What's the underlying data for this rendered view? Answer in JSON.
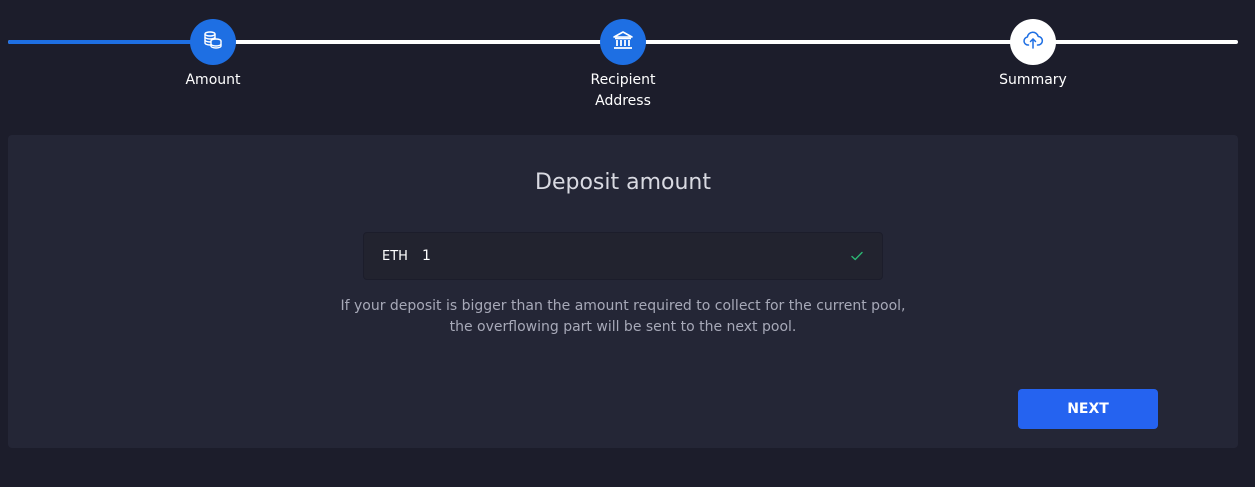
{
  "stepper": {
    "steps": [
      {
        "label": "Amount",
        "icon": "coins-icon",
        "state": "active"
      },
      {
        "label": "Recipient Address",
        "icon": "bank-icon",
        "state": "active"
      },
      {
        "label": "Summary",
        "icon": "cloud-upload-icon",
        "state": "inactive"
      }
    ],
    "colors": {
      "active": "#1e6fe3",
      "inactive": "#ffffff"
    }
  },
  "deposit": {
    "title": "Deposit amount",
    "currency": "ETH",
    "amount_value": "1",
    "valid_icon": "check-icon",
    "help_text": "If your deposit is bigger than the amount required to collect for the current pool, the overflowing part will be sent to the next pool.",
    "next_label": "NEXT"
  },
  "colors": {
    "background": "#1c1d2b",
    "card": "#242636",
    "accent": "#2563f0",
    "valid": "#2bb673"
  }
}
